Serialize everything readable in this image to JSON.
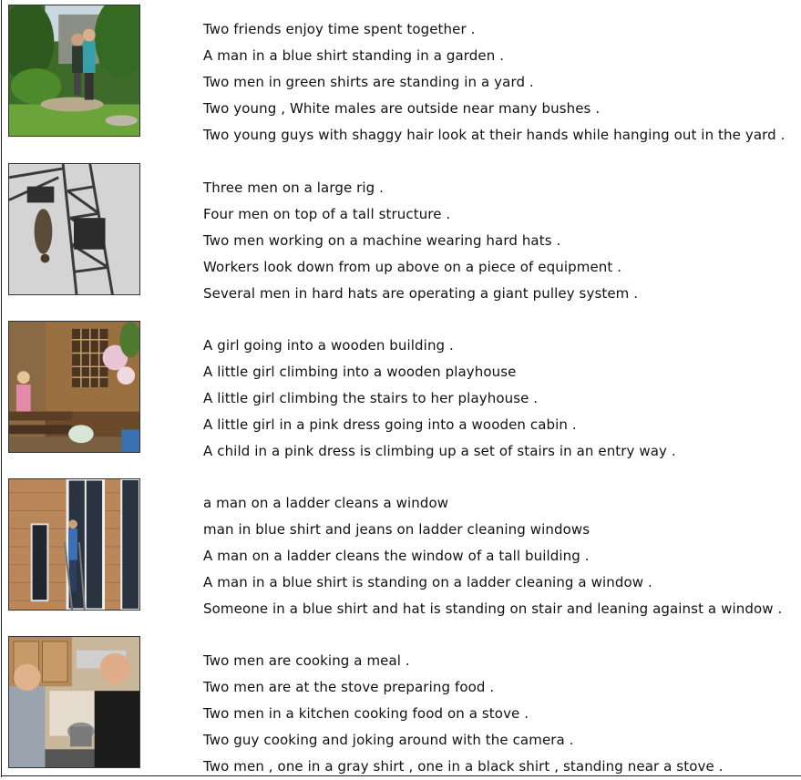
{
  "entries": [
    {
      "image": "garden-two-friends",
      "captions": [
        "Two friends enjoy time spent together .",
        "A man in a blue shirt standing in a garden .",
        "Two men in green shirts are standing in a yard .",
        "Two young , White males are outside near many bushes .",
        "Two young guys with shaggy hair look at their hands while hanging out in the yard ."
      ]
    },
    {
      "image": "men-on-rig",
      "captions": [
        "Three men on a large rig .",
        "Four men on top of a tall structure .",
        "Two men working on a machine wearing hard hats .",
        "Workers look down from up above on a piece of equipment .",
        "Several men in hard hats are operating a giant pulley system ."
      ]
    },
    {
      "image": "girl-wooden-playhouse",
      "captions": [
        "A girl going into a wooden building .",
        "A little girl climbing into a wooden playhouse",
        "A little girl climbing the stairs to her playhouse .",
        "A little girl in a pink dress going into a wooden cabin .",
        "A child in a pink dress is climbing up a set of stairs in an entry way ."
      ]
    },
    {
      "image": "man-ladder-window",
      "captions": [
        "a man on a ladder cleans a window",
        "man in blue shirt and jeans on ladder cleaning windows",
        "A man on a ladder cleans the window of a tall building .",
        "A man in a blue shirt is standing on a ladder cleaning a window .",
        "Someone in a blue shirt and hat is standing on stair and leaning against a window ."
      ]
    },
    {
      "image": "men-cooking-kitchen",
      "captions": [
        "Two men are cooking a meal .",
        "Two men are at the stove preparing food .",
        "Two men in a kitchen cooking food on a stove .",
        "Two guy cooking and joking around with the camera .",
        "Two men , one in a gray shirt , one in a black shirt , standing near a stove ."
      ]
    }
  ]
}
